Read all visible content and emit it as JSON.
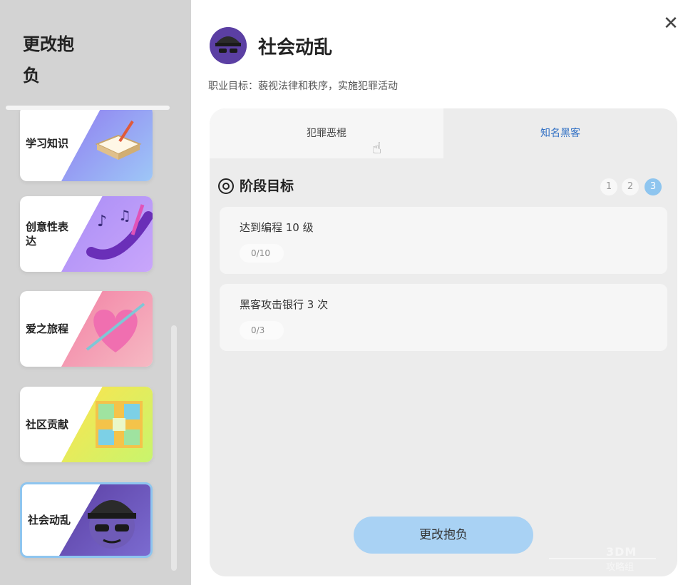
{
  "sidebar": {
    "title": "更改抱负",
    "items": [
      {
        "label": "学习知识",
        "colors": [
          "#8f7cf0",
          "#9ec7f7"
        ]
      },
      {
        "label": "创意性表达",
        "colors": [
          "#a98df5",
          "#c9a6fb"
        ]
      },
      {
        "label": "爱之旅程",
        "colors": [
          "#f281a4",
          "#f6b9c3"
        ]
      },
      {
        "label": "社区贡献",
        "colors": [
          "#ffe34d",
          "#c8f56d"
        ]
      },
      {
        "label": "社会动乱",
        "colors": [
          "#5b3fa3",
          "#7b6bd0"
        ],
        "selected": true
      }
    ]
  },
  "panel": {
    "title": "社会动乱",
    "goal": "职业目标：藐视法律和秩序，实施犯罪活动",
    "close_icon": "close-icon",
    "tabs": [
      {
        "label": "犯罪恶棍"
      },
      {
        "label": "知名黑客",
        "active": true
      }
    ],
    "stage": {
      "title": "阶段目标",
      "steps": [
        "1",
        "2",
        "3"
      ],
      "current": "3"
    },
    "goals": [
      {
        "name": "达到编程 10 级",
        "progress": "0/10"
      },
      {
        "name": "黑客攻击银行 3 次",
        "progress": "0/3"
      }
    ],
    "button_label": "更改抱负"
  },
  "watermark": {
    "line1": "3DM",
    "line2": "攻略组"
  },
  "accent_color": "#8ec5ef"
}
